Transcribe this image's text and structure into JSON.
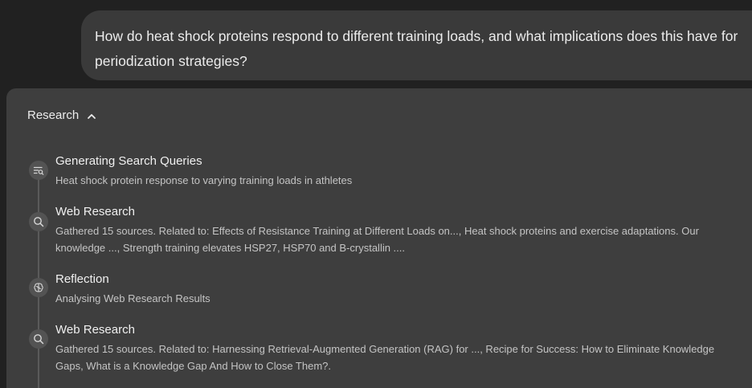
{
  "user_message": {
    "text": "How do heat shock proteins respond to different training loads, and what implications does this have for periodization strategies?"
  },
  "research": {
    "header_label": "Research",
    "steps": [
      {
        "icon": "search-queries-icon",
        "title": "Generating Search Queries",
        "description": "Heat shock protein response to varying training loads in athletes"
      },
      {
        "icon": "search-icon",
        "title": "Web Research",
        "description": "Gathered 15 sources. Related to: Effects of Resistance Training at Different Loads on..., Heat shock proteins and exercise adaptations. Our knowledge ..., Strength training elevates HSP27, HSP70 and B-crystallin ...."
      },
      {
        "icon": "brain-icon",
        "title": "Reflection",
        "description": "Analysing Web Research Results"
      },
      {
        "icon": "search-icon",
        "title": "Web Research",
        "description": "Gathered 15 sources. Related to: Harnessing Retrieval-Augmented Generation (RAG) for ..., Recipe for Success: How to Eliminate Knowledge Gaps, What is a Knowledge Gap And How to Close Them?."
      }
    ]
  }
}
